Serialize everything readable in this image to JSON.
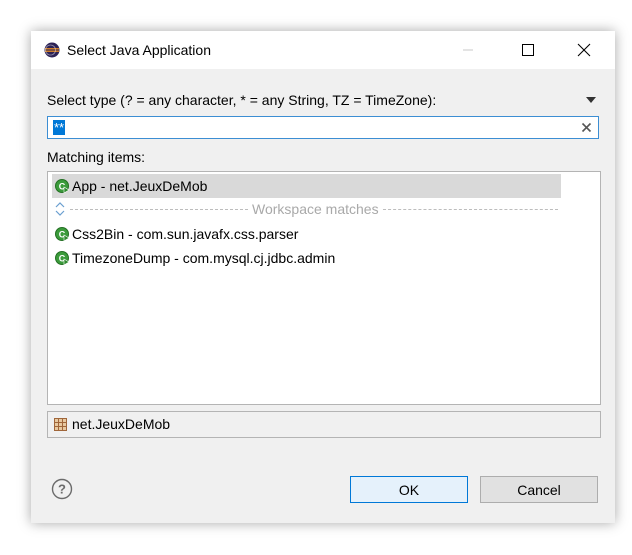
{
  "window": {
    "title": "Select Java Application",
    "minimize_icon": "minimize-icon",
    "maximize_icon": "maximize-icon",
    "close_icon": "close-icon"
  },
  "filter": {
    "label": "Select type (? = any character, * = any String, TZ = TimeZone):",
    "value": "**",
    "clear_icon": "clear-icon",
    "menu_icon": "dropdown-menu-icon"
  },
  "matching": {
    "label": "Matching items:",
    "items": [
      {
        "name": "App - net.JeuxDeMob",
        "icon": "java-main-class-icon",
        "selected": true
      },
      {
        "name": "Css2Bin - com.sun.javafx.css.parser",
        "icon": "java-main-class-icon",
        "selected": false
      },
      {
        "name": "TimezoneDump - com.mysql.cj.jdbc.admin",
        "icon": "java-main-class-icon",
        "selected": false
      }
    ],
    "separator": "Workspace matches"
  },
  "package": {
    "name": "net.JeuxDeMob",
    "icon": "package-icon"
  },
  "buttons": {
    "ok": "OK",
    "cancel": "Cancel",
    "help_icon": "help-icon"
  },
  "colors": {
    "accent": "#0078d7",
    "selection": "#d9d9d9",
    "dialog_bg": "#f0f0f0"
  }
}
